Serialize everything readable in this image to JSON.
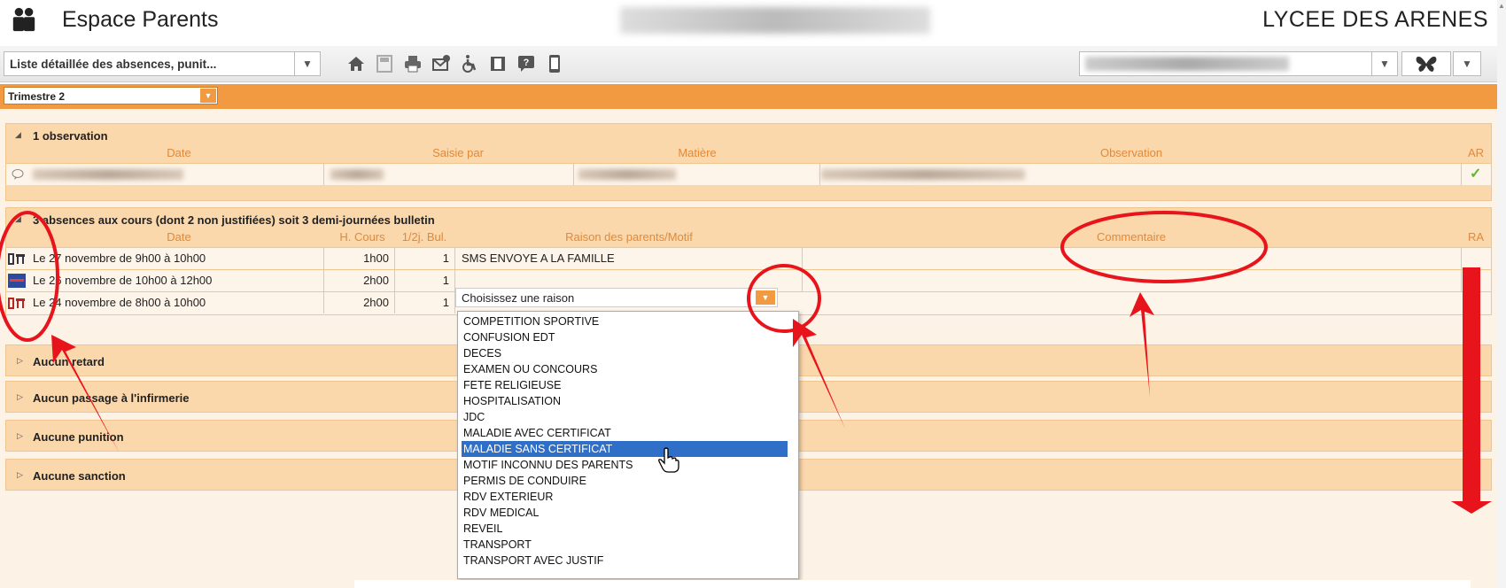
{
  "header": {
    "app_title": "Espace Parents",
    "school_name": "LYCEE DES ARENES"
  },
  "toolbar": {
    "page_select_label": "Liste détaillée des absences, punit...",
    "icons": [
      "home-icon",
      "save-icon",
      "print-icon",
      "email-icon",
      "accessibility-icon",
      "film-icon",
      "help-icon",
      "mobile-icon"
    ]
  },
  "period": {
    "selected": "Trimestre 2"
  },
  "observations": {
    "title": "1 observation",
    "headers": {
      "date": "Date",
      "saisie": "Saisie par",
      "matiere": "Matière",
      "observation": "Observation",
      "ar": "AR"
    },
    "ack_mark": "✓"
  },
  "absences": {
    "title": "3 absences aux cours (dont 2 non justifiées) soit 3 demi-journées bulletin",
    "headers": {
      "date": "Date",
      "hcours": "H. Cours",
      "demi": "1/2j. Bul.",
      "raison": "Raison des parents/Motif",
      "commentaire": "Commentaire",
      "ra": "RA"
    },
    "rows": [
      {
        "date": "Le 27 novembre de 9h00 à 10h00",
        "hcours": "1h00",
        "demi": "1",
        "raison": "SMS ENVOYE A LA FAMILLE"
      },
      {
        "date": "Le 26 novembre de 10h00 à 12h00",
        "hcours": "2h00",
        "demi": "1",
        "raison": "Choisissez une raison"
      },
      {
        "date": "Le 24 novembre de 8h00 à 10h00",
        "hcours": "2h00",
        "demi": "1",
        "raison": ""
      }
    ]
  },
  "collapsed_sections": [
    "Aucun retard",
    "Aucun passage à l'infirmerie",
    "Aucune punition",
    "Aucune sanction"
  ],
  "reason_options": [
    "COMPETITION SPORTIVE",
    "CONFUSION EDT",
    "DECES",
    "EXAMEN OU CONCOURS",
    "FETE RELIGIEUSE",
    "HOSPITALISATION",
    "JDC",
    "MALADIE AVEC CERTIFICAT",
    "MALADIE SANS CERTIFICAT",
    "MOTIF INCONNU DES PARENTS",
    "PERMIS DE CONDUIRE",
    "RDV EXTERIEUR",
    "RDV MEDICAL",
    "REVEIL",
    "TRANSPORT",
    "TRANSPORT AVEC JUSTIF"
  ],
  "highlighted_option": "MALADIE SANS CERTIFICAT",
  "colors": {
    "accent_orange": "#f19a42",
    "section_bg": "#fbd7ac",
    "header_text": "#e08a3a",
    "annotation_red": "#e8141b",
    "selection_blue": "#2f6fc8"
  }
}
